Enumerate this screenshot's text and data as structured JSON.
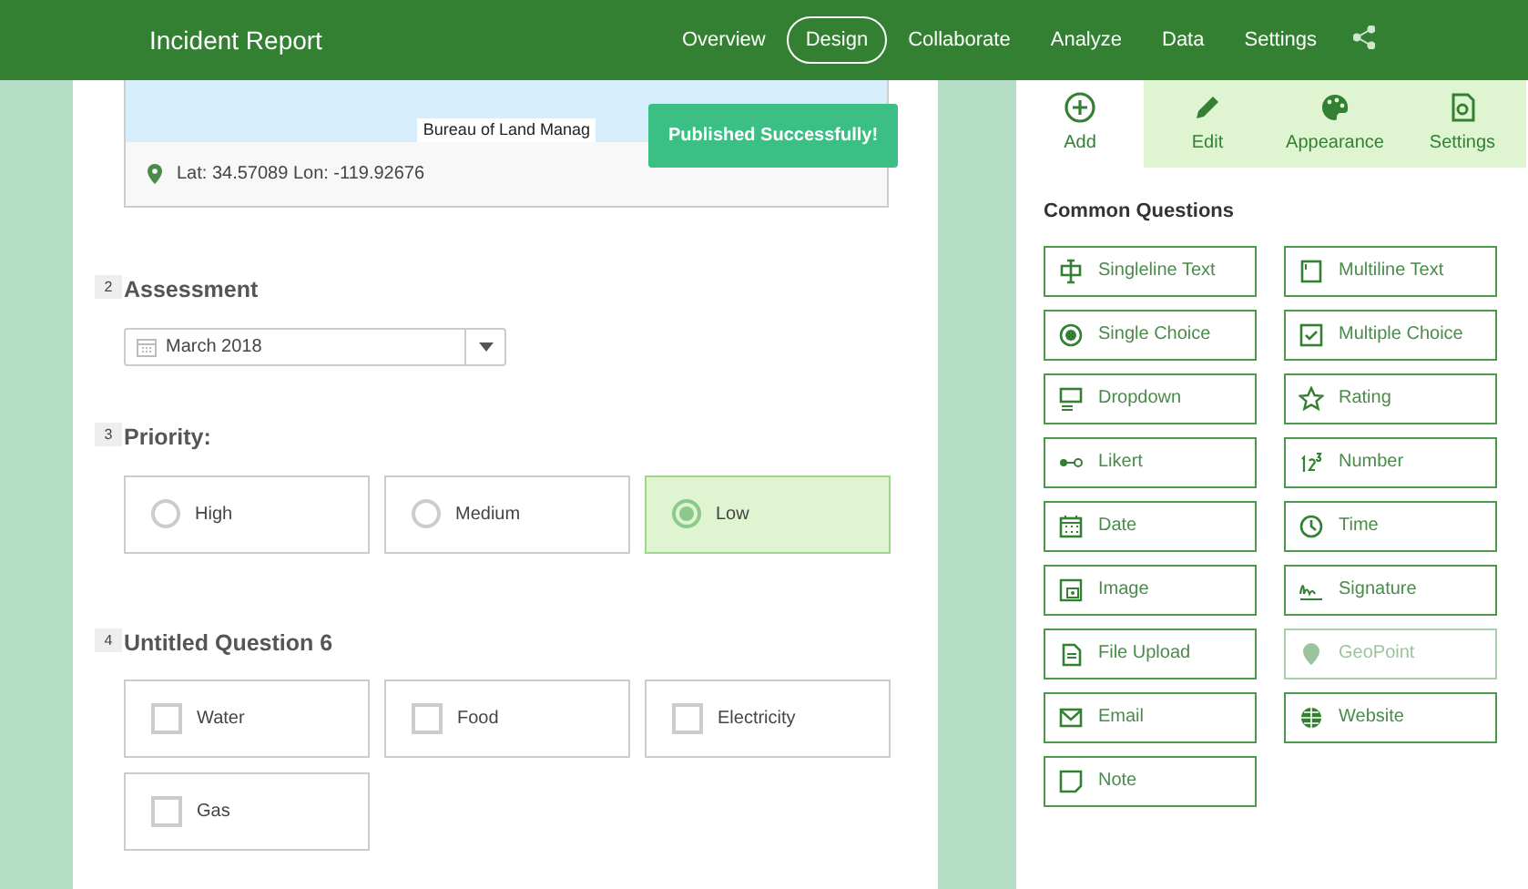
{
  "header": {
    "title": "Incident Report",
    "nav": [
      {
        "label": "Overview",
        "selected": false
      },
      {
        "label": "Design",
        "selected": true
      },
      {
        "label": "Collaborate",
        "selected": false
      },
      {
        "label": "Analyze",
        "selected": false
      },
      {
        "label": "Data",
        "selected": false
      },
      {
        "label": "Settings",
        "selected": false
      }
    ]
  },
  "map": {
    "attribution": "Bureau of Land Manag",
    "location": "Lat: 34.57089 Lon: -119.92676"
  },
  "toast": "Published Successfully!",
  "questions": [
    {
      "kind": "date",
      "number": "2",
      "title": "Assessment",
      "value": "March 2018"
    },
    {
      "kind": "radio",
      "number": "3",
      "title": "Priority:",
      "options": [
        {
          "label": "High",
          "selected": false
        },
        {
          "label": "Medium",
          "selected": false
        },
        {
          "label": "Low",
          "selected": true
        }
      ]
    },
    {
      "kind": "checkbox",
      "number": "4",
      "title": "Untitled Question 6",
      "options": [
        {
          "label": "Water",
          "checked": false
        },
        {
          "label": "Food",
          "checked": false
        },
        {
          "label": "Electricity",
          "checked": false
        },
        {
          "label": "Gas",
          "checked": false
        }
      ]
    }
  ],
  "toolbar": [
    {
      "label": "Add",
      "selected": true
    },
    {
      "label": "Edit",
      "selected": false
    },
    {
      "label": "Appearance",
      "selected": false
    },
    {
      "label": "Settings",
      "selected": false
    }
  ],
  "palette": {
    "title": "Common Questions",
    "items": [
      {
        "label": "Singleline Text",
        "disabled": false
      },
      {
        "label": "Multiline Text",
        "disabled": false
      },
      {
        "label": "Single Choice",
        "disabled": false
      },
      {
        "label": "Multiple Choice",
        "disabled": false
      },
      {
        "label": "Dropdown",
        "disabled": false
      },
      {
        "label": "Rating",
        "disabled": false
      },
      {
        "label": "Likert",
        "disabled": false
      },
      {
        "label": "Number",
        "disabled": false
      },
      {
        "label": "Date",
        "disabled": false
      },
      {
        "label": "Time",
        "disabled": false
      },
      {
        "label": "Image",
        "disabled": false
      },
      {
        "label": "Signature",
        "disabled": false
      },
      {
        "label": "File Upload",
        "disabled": false
      },
      {
        "label": "GeoPoint",
        "disabled": true
      },
      {
        "label": "Email",
        "disabled": false
      },
      {
        "label": "Website",
        "disabled": false
      },
      {
        "label": "Note",
        "disabled": false
      }
    ]
  }
}
